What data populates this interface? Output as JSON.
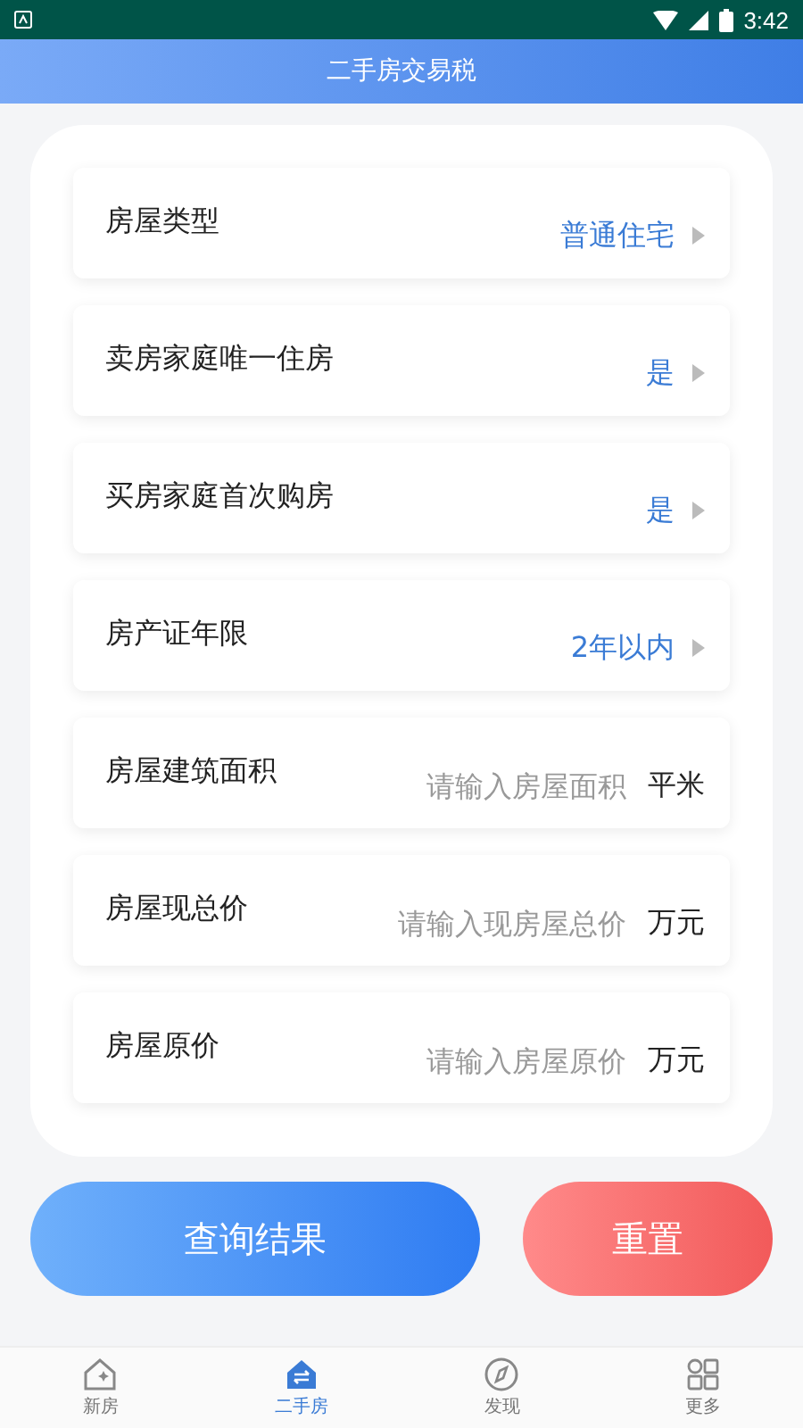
{
  "status_bar": {
    "time": "3:42"
  },
  "header": {
    "title": "二手房交易税"
  },
  "rows": [
    {
      "kind": "select",
      "label": "房屋类型",
      "value": "普通住宅"
    },
    {
      "kind": "select",
      "label": "卖房家庭唯一住房",
      "value": "是"
    },
    {
      "kind": "select",
      "label": "买房家庭首次购房",
      "value": "是"
    },
    {
      "kind": "select",
      "label": "房产证年限",
      "value": "2年以内"
    },
    {
      "kind": "input",
      "label": "房屋建筑面积",
      "placeholder": "请输入房屋面积",
      "unit": "平米"
    },
    {
      "kind": "input",
      "label": "房屋现总价",
      "placeholder": "请输入现房屋总价",
      "unit": "万元"
    },
    {
      "kind": "input",
      "label": "房屋原价",
      "placeholder": "请输入房屋原价",
      "unit": "万元"
    }
  ],
  "buttons": {
    "query": "查询结果",
    "reset": "重置"
  },
  "tabs": [
    {
      "kind": "new",
      "label": "新房",
      "selected": false
    },
    {
      "kind": "second",
      "label": "二手房",
      "selected": true
    },
    {
      "kind": "discover",
      "label": "发现",
      "selected": false
    },
    {
      "kind": "more",
      "label": "更多",
      "selected": false
    }
  ]
}
